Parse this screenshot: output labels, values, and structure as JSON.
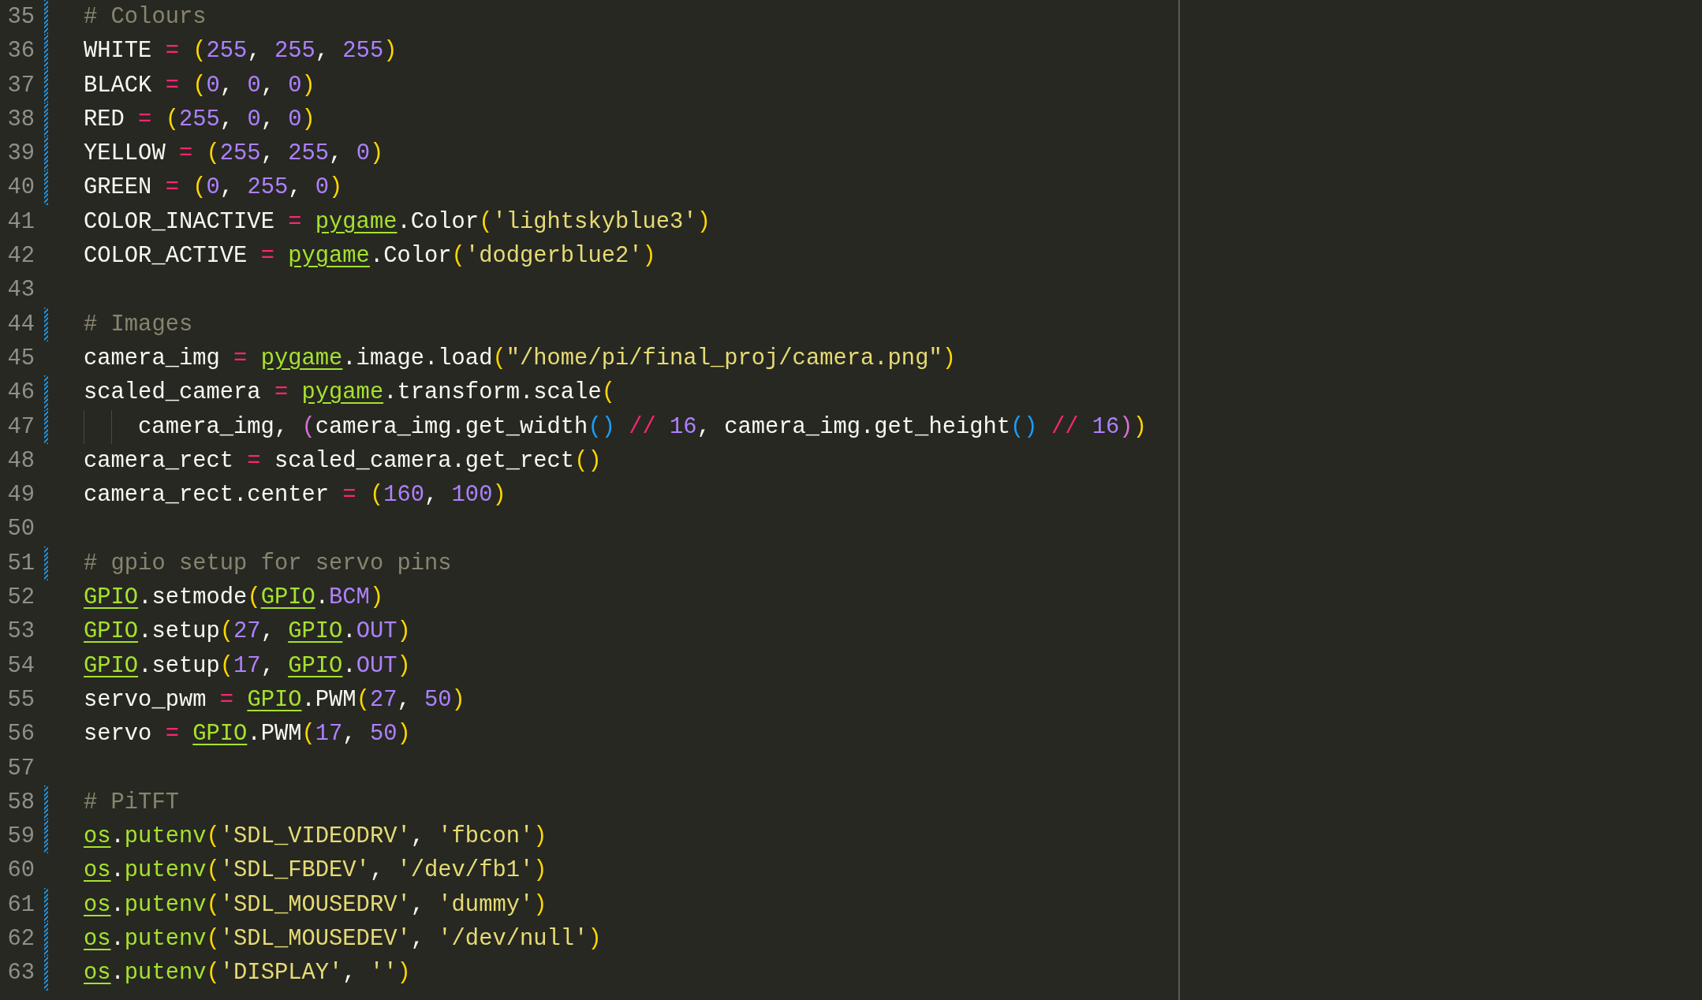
{
  "editor": {
    "lines": [
      {
        "number": "35",
        "modified": true,
        "tokens": [
          {
            "kind": "comment",
            "text": "# Colours"
          }
        ]
      },
      {
        "number": "36",
        "modified": true,
        "tokens": [
          {
            "kind": "plain",
            "text": "WHITE"
          },
          {
            "kind": "operator",
            "text": " = "
          },
          {
            "kind": "bracket",
            "text": "("
          },
          {
            "kind": "number",
            "text": "255"
          },
          {
            "kind": "plain",
            "text": ", "
          },
          {
            "kind": "number",
            "text": "255"
          },
          {
            "kind": "plain",
            "text": ", "
          },
          {
            "kind": "number",
            "text": "255"
          },
          {
            "kind": "bracket",
            "text": ")"
          }
        ]
      },
      {
        "number": "37",
        "modified": true,
        "tokens": [
          {
            "kind": "plain",
            "text": "BLACK"
          },
          {
            "kind": "operator",
            "text": " = "
          },
          {
            "kind": "bracket",
            "text": "("
          },
          {
            "kind": "number",
            "text": "0"
          },
          {
            "kind": "plain",
            "text": ", "
          },
          {
            "kind": "number",
            "text": "0"
          },
          {
            "kind": "plain",
            "text": ", "
          },
          {
            "kind": "number",
            "text": "0"
          },
          {
            "kind": "bracket",
            "text": ")"
          }
        ]
      },
      {
        "number": "38",
        "modified": true,
        "tokens": [
          {
            "kind": "plain",
            "text": "RED"
          },
          {
            "kind": "operator",
            "text": " = "
          },
          {
            "kind": "bracket",
            "text": "("
          },
          {
            "kind": "number",
            "text": "255"
          },
          {
            "kind": "plain",
            "text": ", "
          },
          {
            "kind": "number",
            "text": "0"
          },
          {
            "kind": "plain",
            "text": ", "
          },
          {
            "kind": "number",
            "text": "0"
          },
          {
            "kind": "bracket",
            "text": ")"
          }
        ]
      },
      {
        "number": "39",
        "modified": true,
        "tokens": [
          {
            "kind": "plain",
            "text": "YELLOW"
          },
          {
            "kind": "operator",
            "text": " = "
          },
          {
            "kind": "bracket",
            "text": "("
          },
          {
            "kind": "number",
            "text": "255"
          },
          {
            "kind": "plain",
            "text": ", "
          },
          {
            "kind": "number",
            "text": "255"
          },
          {
            "kind": "plain",
            "text": ", "
          },
          {
            "kind": "number",
            "text": "0"
          },
          {
            "kind": "bracket",
            "text": ")"
          }
        ]
      },
      {
        "number": "40",
        "modified": true,
        "tokens": [
          {
            "kind": "plain",
            "text": "GREEN"
          },
          {
            "kind": "operator",
            "text": " = "
          },
          {
            "kind": "bracket",
            "text": "("
          },
          {
            "kind": "number",
            "text": "0"
          },
          {
            "kind": "plain",
            "text": ", "
          },
          {
            "kind": "number",
            "text": "255"
          },
          {
            "kind": "plain",
            "text": ", "
          },
          {
            "kind": "number",
            "text": "0"
          },
          {
            "kind": "bracket",
            "text": ")"
          }
        ]
      },
      {
        "number": "41",
        "modified": false,
        "tokens": [
          {
            "kind": "plain",
            "text": "COLOR_INACTIVE"
          },
          {
            "kind": "operator",
            "text": " = "
          },
          {
            "kind": "module",
            "text": "pygame"
          },
          {
            "kind": "plain",
            "text": ".Color"
          },
          {
            "kind": "bracket",
            "text": "("
          },
          {
            "kind": "string",
            "text": "'lightskyblue3'"
          },
          {
            "kind": "bracket",
            "text": ")"
          }
        ]
      },
      {
        "number": "42",
        "modified": false,
        "tokens": [
          {
            "kind": "plain",
            "text": "COLOR_ACTIVE"
          },
          {
            "kind": "operator",
            "text": " = "
          },
          {
            "kind": "module",
            "text": "pygame"
          },
          {
            "kind": "plain",
            "text": ".Color"
          },
          {
            "kind": "bracket",
            "text": "("
          },
          {
            "kind": "string",
            "text": "'dodgerblue2'"
          },
          {
            "kind": "bracket",
            "text": ")"
          }
        ]
      },
      {
        "number": "43",
        "modified": false
      },
      {
        "number": "44",
        "modified": true,
        "tokens": [
          {
            "kind": "comment",
            "text": "# Images"
          }
        ]
      },
      {
        "number": "45",
        "modified": false,
        "tokens": [
          {
            "kind": "plain",
            "text": "camera_img"
          },
          {
            "kind": "operator",
            "text": " = "
          },
          {
            "kind": "module",
            "text": "pygame"
          },
          {
            "kind": "plain",
            "text": ".image.load"
          },
          {
            "kind": "bracket",
            "text": "("
          },
          {
            "kind": "string",
            "text": "\"/home/pi/final_proj/camera.png\""
          },
          {
            "kind": "bracket",
            "text": ")"
          }
        ]
      },
      {
        "number": "46",
        "modified": true,
        "tokens": [
          {
            "kind": "plain",
            "text": "scaled_camera"
          },
          {
            "kind": "operator",
            "text": " = "
          },
          {
            "kind": "module",
            "text": "pygame"
          },
          {
            "kind": "plain",
            "text": ".transform.scale"
          },
          {
            "kind": "bracket",
            "text": "("
          }
        ]
      },
      {
        "number": "47",
        "modified": true,
        "continuation": true,
        "tokens": [
          {
            "kind": "plain",
            "text": "camera_img, "
          },
          {
            "kind": "bracket2",
            "text": "("
          },
          {
            "kind": "plain",
            "text": "camera_img.get_width"
          },
          {
            "kind": "bracket3",
            "text": "()"
          },
          {
            "kind": "operator",
            "text": " // "
          },
          {
            "kind": "number",
            "text": "16"
          },
          {
            "kind": "plain",
            "text": ", camera_img.get_height"
          },
          {
            "kind": "bracket3",
            "text": "()"
          },
          {
            "kind": "operator",
            "text": " // "
          },
          {
            "kind": "number",
            "text": "16"
          },
          {
            "kind": "bracket2",
            "text": ")"
          },
          {
            "kind": "bracket",
            "text": ")"
          }
        ]
      },
      {
        "number": "48",
        "modified": false,
        "tokens": [
          {
            "kind": "plain",
            "text": "camera_rect"
          },
          {
            "kind": "operator",
            "text": " = "
          },
          {
            "kind": "plain",
            "text": "scaled_camera.get_rect"
          },
          {
            "kind": "bracket",
            "text": "()"
          }
        ]
      },
      {
        "number": "49",
        "modified": false,
        "tokens": [
          {
            "kind": "plain",
            "text": "camera_rect.center"
          },
          {
            "kind": "operator",
            "text": " = "
          },
          {
            "kind": "bracket",
            "text": "("
          },
          {
            "kind": "number",
            "text": "160"
          },
          {
            "kind": "plain",
            "text": ", "
          },
          {
            "kind": "number",
            "text": "100"
          },
          {
            "kind": "bracket",
            "text": ")"
          }
        ]
      },
      {
        "number": "50",
        "modified": false
      },
      {
        "number": "51",
        "modified": true,
        "tokens": [
          {
            "kind": "comment",
            "text": "# gpio setup for servo pins"
          }
        ]
      },
      {
        "number": "52",
        "modified": false,
        "tokens": [
          {
            "kind": "module",
            "text": "GPIO"
          },
          {
            "kind": "plain",
            "text": ".setmode"
          },
          {
            "kind": "bracket",
            "text": "("
          },
          {
            "kind": "module",
            "text": "GPIO"
          },
          {
            "kind": "plain",
            "text": "."
          },
          {
            "kind": "number",
            "text": "BCM"
          },
          {
            "kind": "bracket",
            "text": ")"
          }
        ]
      },
      {
        "number": "53",
        "modified": false,
        "tokens": [
          {
            "kind": "module",
            "text": "GPIO"
          },
          {
            "kind": "plain",
            "text": ".setup"
          },
          {
            "kind": "bracket",
            "text": "("
          },
          {
            "kind": "number",
            "text": "27"
          },
          {
            "kind": "plain",
            "text": ", "
          },
          {
            "kind": "module",
            "text": "GPIO"
          },
          {
            "kind": "plain",
            "text": "."
          },
          {
            "kind": "number",
            "text": "OUT"
          },
          {
            "kind": "bracket",
            "text": ")"
          }
        ]
      },
      {
        "number": "54",
        "modified": false,
        "tokens": [
          {
            "kind": "module",
            "text": "GPIO"
          },
          {
            "kind": "plain",
            "text": ".setup"
          },
          {
            "kind": "bracket",
            "text": "("
          },
          {
            "kind": "number",
            "text": "17"
          },
          {
            "kind": "plain",
            "text": ", "
          },
          {
            "kind": "module",
            "text": "GPIO"
          },
          {
            "kind": "plain",
            "text": "."
          },
          {
            "kind": "number",
            "text": "OUT"
          },
          {
            "kind": "bracket",
            "text": ")"
          }
        ]
      },
      {
        "number": "55",
        "modified": false,
        "tokens": [
          {
            "kind": "plain",
            "text": "servo_pwm"
          },
          {
            "kind": "operator",
            "text": " = "
          },
          {
            "kind": "module",
            "text": "GPIO"
          },
          {
            "kind": "plain",
            "text": ".PWM"
          },
          {
            "kind": "bracket",
            "text": "("
          },
          {
            "kind": "number",
            "text": "27"
          },
          {
            "kind": "plain",
            "text": ", "
          },
          {
            "kind": "number",
            "text": "50"
          },
          {
            "kind": "bracket",
            "text": ")"
          }
        ]
      },
      {
        "number": "56",
        "modified": false,
        "tokens": [
          {
            "kind": "plain",
            "text": "servo"
          },
          {
            "kind": "operator",
            "text": " = "
          },
          {
            "kind": "module",
            "text": "GPIO"
          },
          {
            "kind": "plain",
            "text": ".PWM"
          },
          {
            "kind": "bracket",
            "text": "("
          },
          {
            "kind": "number",
            "text": "17"
          },
          {
            "kind": "plain",
            "text": ", "
          },
          {
            "kind": "number",
            "text": "50"
          },
          {
            "kind": "bracket",
            "text": ")"
          }
        ]
      },
      {
        "number": "57",
        "modified": false
      },
      {
        "number": "58",
        "modified": true,
        "tokens": [
          {
            "kind": "comment",
            "text": "# PiTFT"
          }
        ]
      },
      {
        "number": "59",
        "modified": true,
        "tokens": [
          {
            "kind": "module",
            "text": "os"
          },
          {
            "kind": "plain",
            "text": "."
          },
          {
            "kind": "function",
            "text": "putenv"
          },
          {
            "kind": "bracket",
            "text": "("
          },
          {
            "kind": "string",
            "text": "'SDL_VIDEODRV'"
          },
          {
            "kind": "plain",
            "text": ", "
          },
          {
            "kind": "string",
            "text": "'fbcon'"
          },
          {
            "kind": "bracket",
            "text": ")"
          }
        ]
      },
      {
        "number": "60",
        "modified": false,
        "tokens": [
          {
            "kind": "module",
            "text": "os"
          },
          {
            "kind": "plain",
            "text": "."
          },
          {
            "kind": "function",
            "text": "putenv"
          },
          {
            "kind": "bracket",
            "text": "("
          },
          {
            "kind": "string",
            "text": "'SDL_FBDEV'"
          },
          {
            "kind": "plain",
            "text": ", "
          },
          {
            "kind": "string",
            "text": "'/dev/fb1'"
          },
          {
            "kind": "bracket",
            "text": ")"
          }
        ]
      },
      {
        "number": "61",
        "modified": true,
        "tokens": [
          {
            "kind": "module",
            "text": "os"
          },
          {
            "kind": "plain",
            "text": "."
          },
          {
            "kind": "function",
            "text": "putenv"
          },
          {
            "kind": "bracket",
            "text": "("
          },
          {
            "kind": "string",
            "text": "'SDL_MOUSEDRV'"
          },
          {
            "kind": "plain",
            "text": ", "
          },
          {
            "kind": "string",
            "text": "'dummy'"
          },
          {
            "kind": "bracket",
            "text": ")"
          }
        ]
      },
      {
        "number": "62",
        "modified": true,
        "tokens": [
          {
            "kind": "module",
            "text": "os"
          },
          {
            "kind": "plain",
            "text": "."
          },
          {
            "kind": "function",
            "text": "putenv"
          },
          {
            "kind": "bracket",
            "text": "("
          },
          {
            "kind": "string",
            "text": "'SDL_MOUSEDEV'"
          },
          {
            "kind": "plain",
            "text": ", "
          },
          {
            "kind": "string",
            "text": "'/dev/null'"
          },
          {
            "kind": "bracket",
            "text": ")"
          }
        ]
      },
      {
        "number": "63",
        "modified": true,
        "tokens": [
          {
            "kind": "module",
            "text": "os"
          },
          {
            "kind": "plain",
            "text": "."
          },
          {
            "kind": "function",
            "text": "putenv"
          },
          {
            "kind": "bracket",
            "text": "("
          },
          {
            "kind": "string",
            "text": "'DISPLAY'"
          },
          {
            "kind": "plain",
            "text": ", "
          },
          {
            "kind": "string",
            "text": "''"
          },
          {
            "kind": "bracket",
            "text": ")"
          }
        ]
      }
    ]
  }
}
